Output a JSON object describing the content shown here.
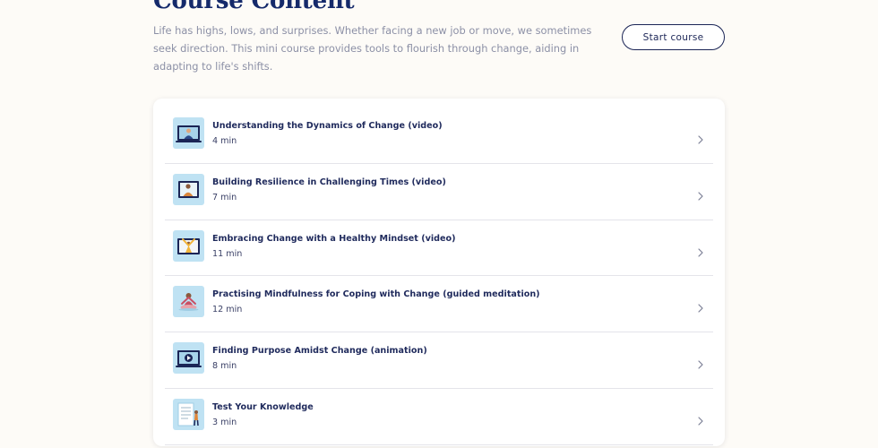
{
  "header": {
    "title": "Course Content",
    "description": "Life has highs, lows, and surprises. Whether facing a new job or move, we sometimes seek direction. This mini course provides tools to flourish through change, aiding in adapting to life's shifts.",
    "start_button_label": "Start course"
  },
  "colors": {
    "background": "#fdfbf7",
    "title": "#152a6b",
    "text": "#1f2a5c",
    "muted_text": "#8c90a6",
    "thumbnail_bg": "#bfe2f3",
    "divider": "#e4e4ea"
  },
  "lessons": [
    {
      "title": "Understanding the Dynamics of Change (video)",
      "duration": "4 min",
      "thumbnail_icon": "video-person-laptop-icon",
      "chevron_icon": "chevron-right-icon"
    },
    {
      "title": "Building Resilience in Challenging Times (video)",
      "duration": "7 min",
      "thumbnail_icon": "video-person-icon",
      "chevron_icon": "chevron-right-icon"
    },
    {
      "title": "Embracing Change with a Healthy Mindset (video)",
      "duration": "11 min",
      "thumbnail_icon": "video-person-arms-up-icon",
      "chevron_icon": "chevron-right-icon"
    },
    {
      "title": "Practising Mindfulness for Coping with Change (guided meditation)",
      "duration": "12 min",
      "thumbnail_icon": "meditation-icon",
      "chevron_icon": "chevron-right-icon"
    },
    {
      "title": "Finding Purpose Amidst Change (animation)",
      "duration": "8 min",
      "thumbnail_icon": "animation-play-icon",
      "chevron_icon": "chevron-right-icon"
    },
    {
      "title": "Test Your Knowledge",
      "duration": "3 min",
      "thumbnail_icon": "quiz-document-icon",
      "chevron_icon": "chevron-right-icon"
    }
  ]
}
